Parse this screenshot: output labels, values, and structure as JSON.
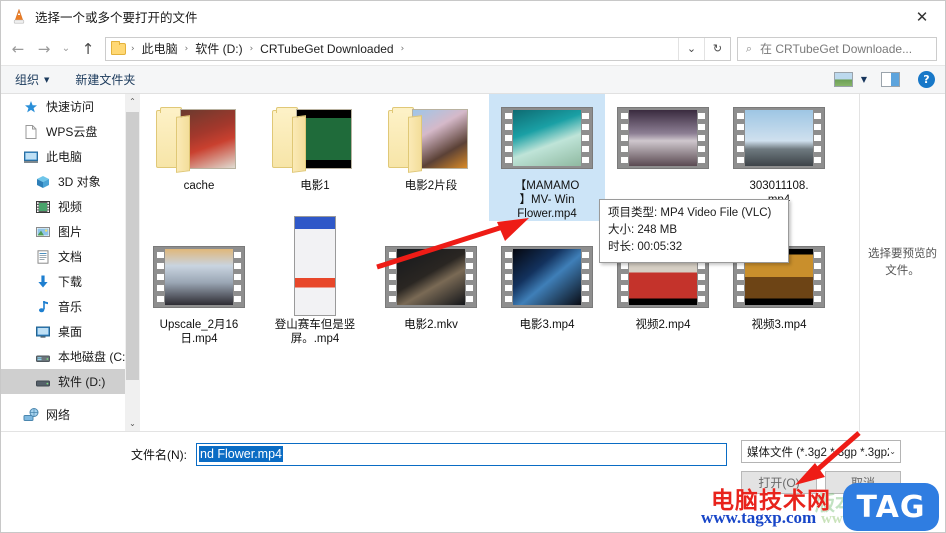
{
  "window": {
    "title": "选择一个或多个要打开的文件",
    "app_icon": "vlc-cone-icon",
    "close_label": "✕"
  },
  "address_bar": {
    "back_icon": "←",
    "forward_icon": "→",
    "recent_icon": "⌄",
    "up_icon": "↑",
    "breadcrumbs": [
      "此电脑",
      "软件 (D:)",
      "CRTubeGet Downloaded"
    ],
    "separator": "›",
    "dropdown_icon": "⌄",
    "refresh_icon": "↻",
    "search_icon": "⌕",
    "search_placeholder": "在 CRTubeGet Downloade..."
  },
  "command_bar": {
    "organize_label": "组织",
    "organize_caret": "▼",
    "new_folder_label": "新建文件夹",
    "view_icon": "view-options-icon",
    "view_caret": "▼",
    "pane_icon": "preview-pane-icon",
    "help_icon": "?"
  },
  "sidebar": {
    "items": [
      {
        "label": "快速访问",
        "icon": "star-icon",
        "level": 0,
        "selected": false
      },
      {
        "label": "WPS云盘",
        "icon": "document-icon",
        "level": 0,
        "selected": false
      },
      {
        "label": "此电脑",
        "icon": "computer-icon",
        "level": 0,
        "selected": false
      },
      {
        "label": "3D 对象",
        "icon": "3d-object-icon",
        "level": 1,
        "selected": false
      },
      {
        "label": "视频",
        "icon": "videos-icon",
        "level": 1,
        "selected": false
      },
      {
        "label": "图片",
        "icon": "pictures-icon",
        "level": 1,
        "selected": false
      },
      {
        "label": "文档",
        "icon": "documents-icon",
        "level": 1,
        "selected": false
      },
      {
        "label": "下载",
        "icon": "downloads-icon",
        "level": 1,
        "selected": false
      },
      {
        "label": "音乐",
        "icon": "music-icon",
        "level": 1,
        "selected": false
      },
      {
        "label": "桌面",
        "icon": "desktop-icon",
        "level": 1,
        "selected": false
      },
      {
        "label": "本地磁盘 (C:)",
        "icon": "drive-icon",
        "level": 1,
        "selected": false
      },
      {
        "label": "软件 (D:)",
        "icon": "drive-icon",
        "level": 1,
        "selected": true
      },
      {
        "label": "网络",
        "icon": "network-icon",
        "level": 0,
        "selected": false
      }
    ],
    "scroll_up_icon": "⌃",
    "scroll_down_icon": "⌄"
  },
  "files": {
    "row1": [
      {
        "name": "cache",
        "type": "folder",
        "art": "art-cache",
        "selected": false
      },
      {
        "name": "电影1",
        "type": "folder",
        "art": "art-movie1",
        "selected": false
      },
      {
        "name": "电影2片段",
        "type": "folder",
        "art": "art-movie2seg",
        "selected": false
      },
      {
        "name": "【MAMAMOO】MV- Wind Flower.mp4",
        "display": "【MAMAMO\n】MV- Win\nFlower.mp4",
        "type": "video",
        "art": "art-mamamoo",
        "selected": true
      },
      {
        "name": "",
        "type": "video",
        "art": "art-file3",
        "selected": false
      },
      {
        "name": "303011108.mp4",
        "display": "303011108.\nmp4",
        "type": "video",
        "art": "art-file4",
        "selected": false
      }
    ],
    "row2": [
      {
        "name": "Upscale_2月16日.mp4",
        "display": "Upscale_2月16\n日.mp4",
        "type": "video",
        "art": "art-upscale",
        "selected": false
      },
      {
        "name": "登山赛车但是竖屏。.mp4",
        "display": "登山赛车但是竖\n屏。.mp4",
        "type": "video",
        "art": "art-climb",
        "selected": false
      },
      {
        "name": "电影2.mkv",
        "type": "video",
        "art": "art-movie2mkv",
        "selected": false
      },
      {
        "name": "电影3.mp4",
        "type": "video",
        "art": "art-movie3",
        "selected": false
      },
      {
        "name": "视频2.mp4",
        "type": "video",
        "art": "art-video2",
        "selected": false
      },
      {
        "name": "视频3.mp4",
        "type": "video",
        "art": "art-video3",
        "selected": false
      }
    ]
  },
  "tooltip": {
    "type_line": "项目类型: MP4 Video File (VLC)",
    "size_line": "大小: 248 MB",
    "duration_line": "时长: 00:05:32"
  },
  "preview_pane": {
    "message": "选择要预览的文件。"
  },
  "footer": {
    "filename_label": "文件名(N):",
    "filename_value": "nd Flower.mp4",
    "filetype_value": "媒体文件 (*.3g2 *.3gp *.3gp2",
    "filetype_caret": "⌄",
    "open_label": "打开(O)",
    "cancel_label": "取消"
  },
  "watermark": {
    "cn_text": "电脑技术网",
    "url_text": "www.tagxp.com",
    "tag_text": "TAG",
    "ghost_text": "版本技术网",
    "ghost_url": "www.xz7.com"
  },
  "colors": {
    "selection_blue": "#cce4f7",
    "accent_blue": "#0a6cc4",
    "annotation_red": "#e8231c",
    "sidebar_selected": "#cfcfcf"
  }
}
